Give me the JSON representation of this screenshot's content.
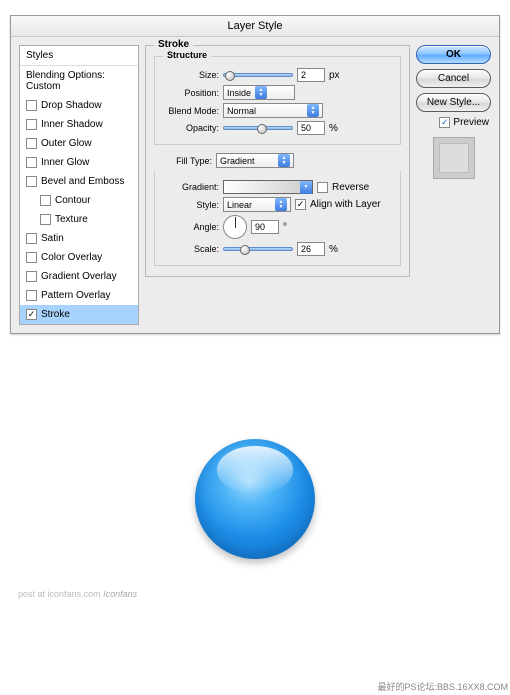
{
  "dialog": {
    "title": "Layer Style"
  },
  "sidebar": {
    "header": "Styles",
    "blending": "Blending Options: Custom",
    "items": [
      {
        "label": "Drop Shadow",
        "checked": false,
        "indent": false
      },
      {
        "label": "Inner Shadow",
        "checked": false,
        "indent": false
      },
      {
        "label": "Outer Glow",
        "checked": false,
        "indent": false
      },
      {
        "label": "Inner Glow",
        "checked": false,
        "indent": false
      },
      {
        "label": "Bevel and Emboss",
        "checked": false,
        "indent": false
      },
      {
        "label": "Contour",
        "checked": false,
        "indent": true
      },
      {
        "label": "Texture",
        "checked": false,
        "indent": true
      },
      {
        "label": "Satin",
        "checked": false,
        "indent": false
      },
      {
        "label": "Color Overlay",
        "checked": false,
        "indent": false
      },
      {
        "label": "Gradient Overlay",
        "checked": false,
        "indent": false
      },
      {
        "label": "Pattern Overlay",
        "checked": false,
        "indent": false
      },
      {
        "label": "Stroke",
        "checked": true,
        "indent": false,
        "selected": true
      }
    ]
  },
  "panel": {
    "title": "Stroke",
    "structure": {
      "title": "Structure",
      "size_label": "Size:",
      "size_value": "2",
      "size_unit": "px",
      "position_label": "Position:",
      "position_value": "Inside",
      "blend_label": "Blend Mode:",
      "blend_value": "Normal",
      "opacity_label": "Opacity:",
      "opacity_value": "50",
      "opacity_unit": "%"
    },
    "fill": {
      "label": "Fill Type:",
      "value": "Gradient",
      "gradient_label": "Gradient:",
      "reverse_label": "Reverse",
      "reverse_checked": false,
      "style_label": "Style:",
      "style_value": "Linear",
      "align_label": "Align with Layer",
      "align_checked": true,
      "angle_label": "Angle:",
      "angle_value": "90",
      "angle_unit": "°",
      "scale_label": "Scale:",
      "scale_value": "26",
      "scale_unit": "%"
    }
  },
  "buttons": {
    "ok": "OK",
    "cancel": "Cancel",
    "newstyle": "New Style...",
    "preview": "Preview",
    "preview_checked": true
  },
  "footer": {
    "left_a": "post at",
    "left_b": "iconfans.com",
    "left_c": "Iconfans",
    "corner": "最好的PS论坛:BBS.16XX8.COM"
  }
}
